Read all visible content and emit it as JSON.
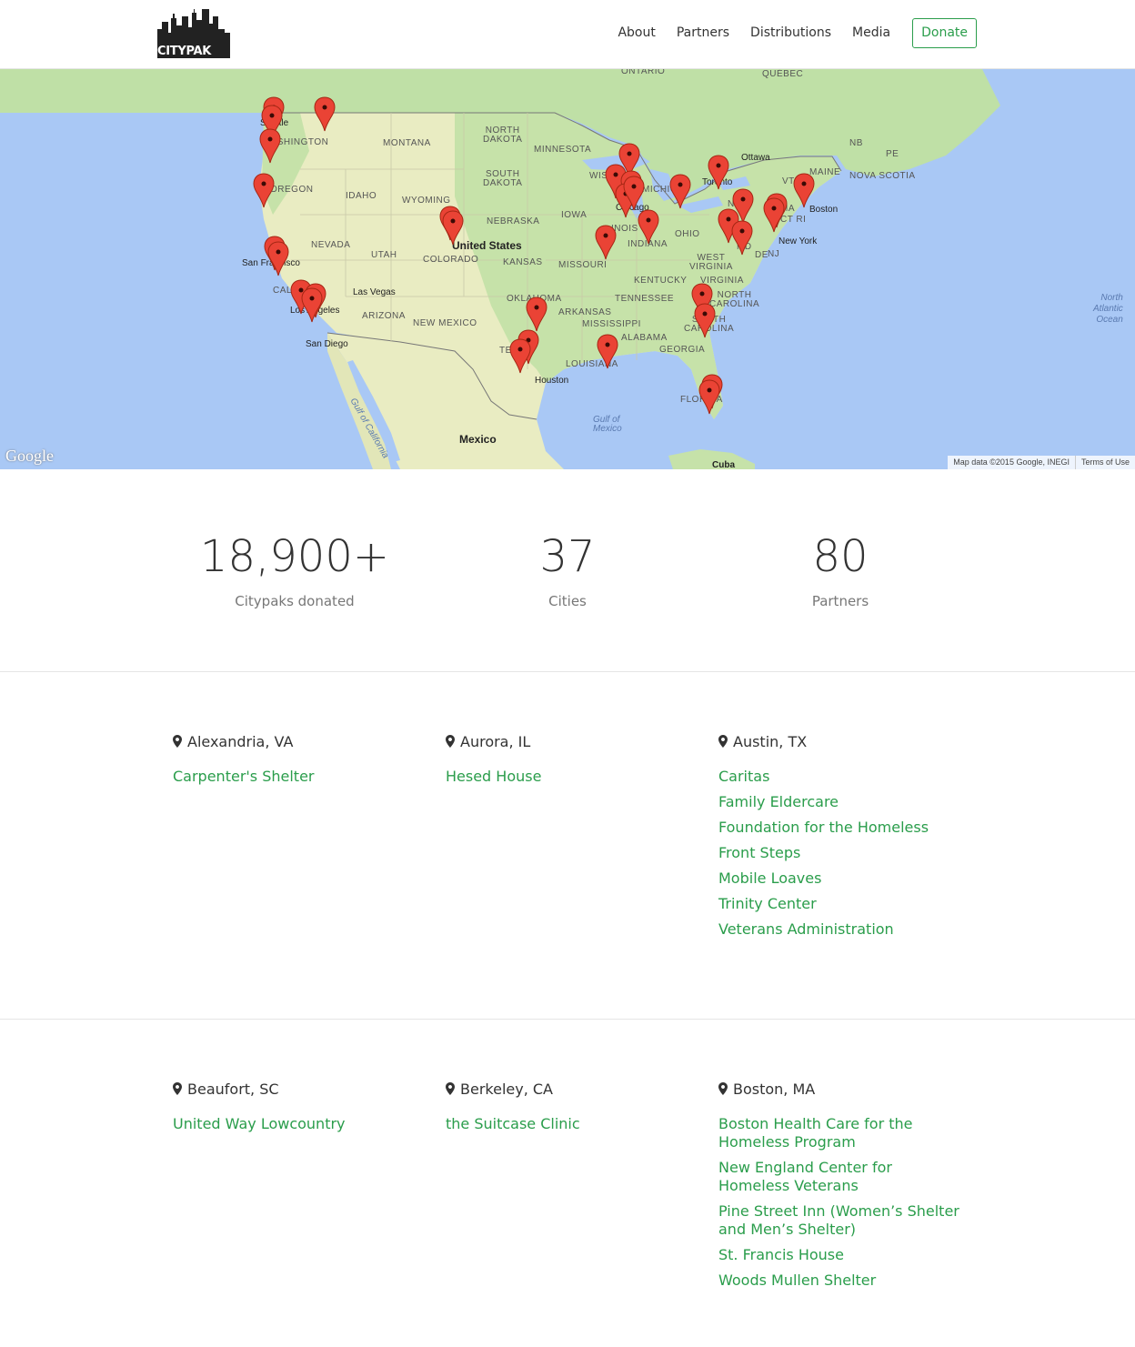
{
  "header": {
    "logo_text": "CITYPAK",
    "nav": [
      "About",
      "Partners",
      "Distributions",
      "Media"
    ],
    "donate_label": "Donate",
    "accent_color": "#2a9d4b"
  },
  "map": {
    "labels": {
      "ontario": "ONTARIO",
      "quebec": "QUÉBEC",
      "nb": "NB",
      "pe": "PE",
      "ottawa": "Ottawa",
      "maine": "MAINE",
      "nova_scotia": "NOVA SCOTIA",
      "vt": "VT",
      "toronto": "Toronto",
      "boston": "Boston",
      "new_york": "New York",
      "ny": "NY",
      "ct_ri": "CT RI",
      "ma": "MA",
      "nj": "NJ",
      "de": "DE",
      "md": "MD",
      "seattle": "Seattle",
      "washington": "WASHINGTON",
      "montana": "MONTANA",
      "north_dakota": "NORTH\nDAKOTA",
      "minnesota": "MINNESOTA",
      "south_dakota": "SOUTH\nDAKOTA",
      "wisconsin": "WIS",
      "michigan": "MICHIG",
      "oregon": "OREGON",
      "idaho": "IDAHO",
      "wyoming": "WYOMING",
      "nebraska": "NEBRASKA",
      "iowa": "IOWA",
      "illinois": "INOIS",
      "indiana": "INDIANA",
      "ohio": "OHIO",
      "chicago": "Chicago",
      "united_states": "United States",
      "nevada": "NEVADA",
      "utah": "UTAH",
      "colorado": "COLORADO",
      "kansas": "KANSAS",
      "missouri": "MISSOURI",
      "kentucky": "KENTUCKY",
      "west_virginia": "WEST\nVIRGINIA",
      "virginia": "VIRGINIA",
      "san_francisco": "San Francisco",
      "california": "CAL",
      "las_vegas": "Las Vegas",
      "los_angeles": "Los Angeles",
      "arizona": "ARIZONA",
      "new_mexico": "NEW MEXICO",
      "oklahoma": "OKLAHOMA",
      "arkansas": "ARKANSAS",
      "tennessee": "TENNESSEE",
      "north_carolina": "NORTH\nCAROLINA",
      "south_carolina": "SOUTH\nCAROLINA",
      "mississippi": "MISSISSIPPI",
      "alabama": "ALABAMA",
      "georgia": "GEORGIA",
      "san_diego": "San Diego",
      "texas": "TE",
      "houston": "Houston",
      "louisiana": "LOUISIANA",
      "florida": "FLORIDA",
      "gulf_of_california": "Gulf of California",
      "gulf_of_mexico": "Gulf of\nMexico",
      "mexico": "Mexico",
      "cuba": "Cuba",
      "north_atlantic": "North\nAtlantic\nOcean"
    },
    "google_logo": "Google",
    "attribution": "Map data ©2015 Google, INEGI",
    "terms": "Terms of Use"
  },
  "stats": [
    {
      "value": "18,900+",
      "label": "Citypaks donated"
    },
    {
      "value": "37",
      "label": "Cities"
    },
    {
      "value": "80",
      "label": "Partners"
    }
  ],
  "cities": [
    {
      "name": "Alexandria, VA",
      "partners": [
        "Carpenter's Shelter"
      ]
    },
    {
      "name": "Aurora, IL",
      "partners": [
        "Hesed House"
      ]
    },
    {
      "name": "Austin, TX",
      "partners": [
        "Caritas",
        "Family Eldercare",
        "Foundation for the Homeless",
        "Front Steps",
        "Mobile Loaves",
        "Trinity Center",
        "Veterans Administration"
      ]
    },
    {
      "name": "Beaufort, SC",
      "partners": [
        "United Way Lowcountry"
      ]
    },
    {
      "name": "Berkeley, CA",
      "partners": [
        "the Suitcase Clinic"
      ]
    },
    {
      "name": "Boston, MA",
      "partners": [
        "Boston Health Care for the Homeless Program",
        "New England Center for Homeless Veterans",
        "Pine Street Inn (Women’s Shelter and Men’s Shelter)",
        "St. Francis House",
        "Woods Mullen Shelter"
      ]
    }
  ]
}
